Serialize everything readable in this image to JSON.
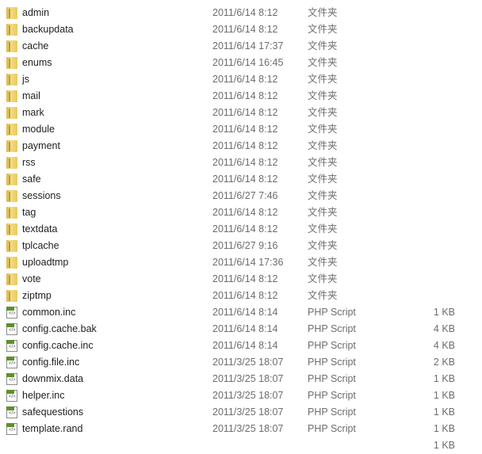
{
  "files": [
    {
      "name": "admin",
      "date": "2011/6/14 8:12",
      "type": "文件夹",
      "size": "",
      "icon": "folder-icon"
    },
    {
      "name": "backupdata",
      "date": "2011/6/14 8:12",
      "type": "文件夹",
      "size": "",
      "icon": "folder-icon"
    },
    {
      "name": "cache",
      "date": "2011/6/14 17:37",
      "type": "文件夹",
      "size": "",
      "icon": "folder-icon"
    },
    {
      "name": "enums",
      "date": "2011/6/14 16:45",
      "type": "文件夹",
      "size": "",
      "icon": "folder-icon"
    },
    {
      "name": "js",
      "date": "2011/6/14 8:12",
      "type": "文件夹",
      "size": "",
      "icon": "folder-icon"
    },
    {
      "name": "mail",
      "date": "2011/6/14 8:12",
      "type": "文件夹",
      "size": "",
      "icon": "folder-icon"
    },
    {
      "name": "mark",
      "date": "2011/6/14 8:12",
      "type": "文件夹",
      "size": "",
      "icon": "folder-icon"
    },
    {
      "name": "module",
      "date": "2011/6/14 8:12",
      "type": "文件夹",
      "size": "",
      "icon": "folder-icon"
    },
    {
      "name": "payment",
      "date": "2011/6/14 8:12",
      "type": "文件夹",
      "size": "",
      "icon": "folder-icon"
    },
    {
      "name": "rss",
      "date": "2011/6/14 8:12",
      "type": "文件夹",
      "size": "",
      "icon": "folder-icon"
    },
    {
      "name": "safe",
      "date": "2011/6/14 8:12",
      "type": "文件夹",
      "size": "",
      "icon": "folder-icon"
    },
    {
      "name": "sessions",
      "date": "2011/6/27 7:46",
      "type": "文件夹",
      "size": "",
      "icon": "folder-icon"
    },
    {
      "name": "tag",
      "date": "2011/6/14 8:12",
      "type": "文件夹",
      "size": "",
      "icon": "folder-icon"
    },
    {
      "name": "textdata",
      "date": "2011/6/14 8:12",
      "type": "文件夹",
      "size": "",
      "icon": "folder-icon"
    },
    {
      "name": "tplcache",
      "date": "2011/6/27 9:16",
      "type": "文件夹",
      "size": "",
      "icon": "folder-icon"
    },
    {
      "name": "uploadtmp",
      "date": "2011/6/14 17:36",
      "type": "文件夹",
      "size": "",
      "icon": "folder-icon"
    },
    {
      "name": "vote",
      "date": "2011/6/14 8:12",
      "type": "文件夹",
      "size": "",
      "icon": "folder-icon"
    },
    {
      "name": "ziptmp",
      "date": "2011/6/14 8:12",
      "type": "文件夹",
      "size": "",
      "icon": "folder-icon"
    },
    {
      "name": "common.inc",
      "date": "2011/6/14 8:14",
      "type": "PHP Script",
      "size": "1 KB",
      "icon": "php-file-icon"
    },
    {
      "name": "config.cache.bak",
      "date": "2011/6/14 8:14",
      "type": "PHP Script",
      "size": "4 KB",
      "icon": "php-file-icon"
    },
    {
      "name": "config.cache.inc",
      "date": "2011/6/14 8:14",
      "type": "PHP Script",
      "size": "4 KB",
      "icon": "php-file-icon"
    },
    {
      "name": "config.file.inc",
      "date": "2011/3/25 18:07",
      "type": "PHP Script",
      "size": "2 KB",
      "icon": "php-file-icon"
    },
    {
      "name": "downmix.data",
      "date": "2011/3/25 18:07",
      "type": "PHP Script",
      "size": "1 KB",
      "icon": "php-file-icon"
    },
    {
      "name": "helper.inc",
      "date": "2011/3/25 18:07",
      "type": "PHP Script",
      "size": "1 KB",
      "icon": "php-file-icon"
    },
    {
      "name": "safequestions",
      "date": "2011/3/25 18:07",
      "type": "PHP Script",
      "size": "1 KB",
      "icon": "php-file-icon"
    },
    {
      "name": "template.rand",
      "date": "2011/3/25 18:07",
      "type": "PHP Script",
      "size": "1 KB",
      "icon": "php-file-icon"
    },
    {
      "name": "",
      "date": "",
      "type": "",
      "size": "1 KB",
      "icon": ""
    }
  ]
}
